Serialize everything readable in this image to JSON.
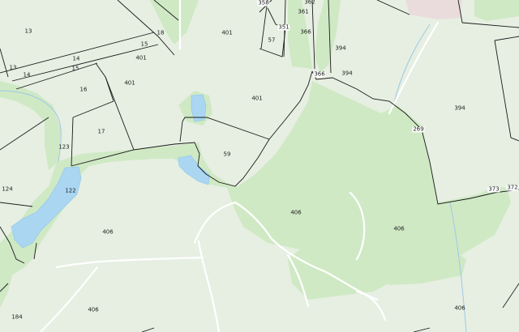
{
  "map": {
    "colors": {
      "land": "#e6efe2",
      "woodland": "#cfe9c4",
      "water": "#aad6f2",
      "road": "#ffffff",
      "parcel_line": "#1a1a1a",
      "built": "#eadcdc"
    },
    "parcel_labels": [
      "13",
      "18",
      "401",
      "358",
      "361",
      "362",
      "351",
      "366",
      "57",
      "394",
      "14",
      "13",
      "401",
      "14",
      "15",
      "15",
      "401",
      "16",
      "366",
      "394",
      "401",
      "394",
      "17",
      "269",
      "123",
      "59",
      "124",
      "122",
      "406",
      "373",
      "372",
      "406",
      "406",
      "406",
      "184",
      "406"
    ]
  }
}
